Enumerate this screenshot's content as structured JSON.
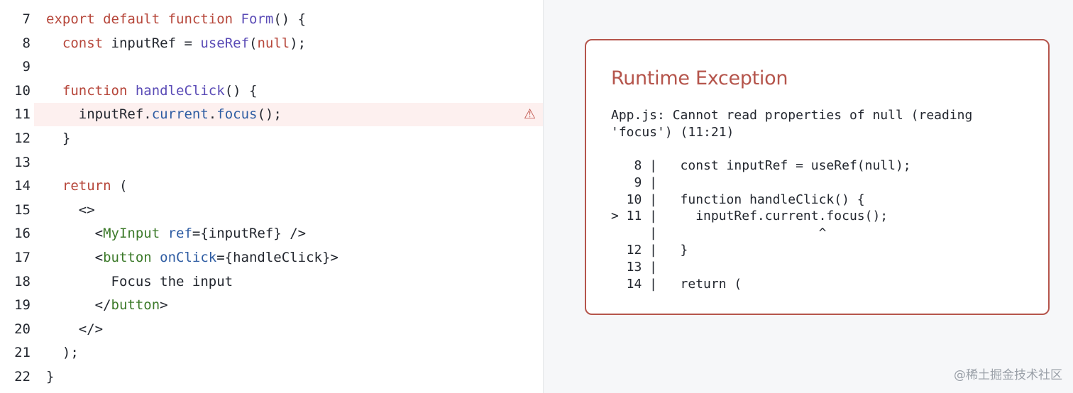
{
  "editor": {
    "lines": [
      {
        "num": "7",
        "tokens": [
          [
            "kw",
            "export "
          ],
          [
            "kw",
            "default "
          ],
          [
            "kw",
            "function "
          ],
          [
            "fn",
            "Form"
          ],
          [
            "plain",
            "() {"
          ]
        ]
      },
      {
        "num": "8",
        "tokens": [
          [
            "plain",
            "  "
          ],
          [
            "kw",
            "const "
          ],
          [
            "plain",
            "inputRef = "
          ],
          [
            "fn",
            "useRef"
          ],
          [
            "plain",
            "("
          ],
          [
            "kw",
            "null"
          ],
          [
            "plain",
            ");"
          ]
        ]
      },
      {
        "num": "9",
        "tokens": []
      },
      {
        "num": "10",
        "tokens": [
          [
            "plain",
            "  "
          ],
          [
            "kw",
            "function "
          ],
          [
            "fn",
            "handleClick"
          ],
          [
            "plain",
            "() {"
          ]
        ]
      },
      {
        "num": "11",
        "error": true,
        "tokens": [
          [
            "plain",
            "    inputRef."
          ],
          [
            "prop",
            "current"
          ],
          [
            "plain",
            "."
          ],
          [
            "prop",
            "focus"
          ],
          [
            "plain",
            "();"
          ]
        ]
      },
      {
        "num": "12",
        "tokens": [
          [
            "plain",
            "  }"
          ]
        ]
      },
      {
        "num": "13",
        "tokens": []
      },
      {
        "num": "14",
        "tokens": [
          [
            "plain",
            "  "
          ],
          [
            "kw",
            "return "
          ],
          [
            "plain",
            "("
          ]
        ]
      },
      {
        "num": "15",
        "tokens": [
          [
            "plain",
            "    <>"
          ]
        ]
      },
      {
        "num": "16",
        "tokens": [
          [
            "plain",
            "      <"
          ],
          [
            "tag",
            "MyInput "
          ],
          [
            "attr",
            "ref"
          ],
          [
            "plain",
            "={inputRef} />"
          ]
        ]
      },
      {
        "num": "17",
        "tokens": [
          [
            "plain",
            "      <"
          ],
          [
            "tag",
            "button "
          ],
          [
            "attr",
            "onClick"
          ],
          [
            "plain",
            "={handleClick}>"
          ]
        ]
      },
      {
        "num": "18",
        "tokens": [
          [
            "plain",
            "        Focus the input"
          ]
        ]
      },
      {
        "num": "19",
        "tokens": [
          [
            "plain",
            "      </"
          ],
          [
            "tag",
            "button"
          ],
          [
            "plain",
            ">"
          ]
        ]
      },
      {
        "num": "20",
        "tokens": [
          [
            "plain",
            "    </>"
          ]
        ]
      },
      {
        "num": "21",
        "tokens": [
          [
            "plain",
            "  );"
          ]
        ]
      },
      {
        "num": "22",
        "tokens": [
          [
            "plain",
            "}"
          ]
        ]
      }
    ],
    "warning_glyph": "⚠"
  },
  "exception": {
    "title": "Runtime Exception",
    "message": "App.js: Cannot read properties of null (reading\n'focus') (11:21)",
    "frame": "   8 |   const inputRef = useRef(null);\n   9 |\n  10 |   function handleClick() {\n> 11 |     inputRef.current.focus();\n     |                     ^\n  12 |   }\n  13 |\n  14 |   return ("
  },
  "watermark": "@稀土掘金技术社区",
  "colors": {
    "keyword": "#b6463a",
    "function": "#5a4bb6",
    "property": "#2f5da3",
    "tag": "#3c7a2a",
    "error_accent": "#b5554c",
    "error_line_bg": "#fdf0ef"
  }
}
